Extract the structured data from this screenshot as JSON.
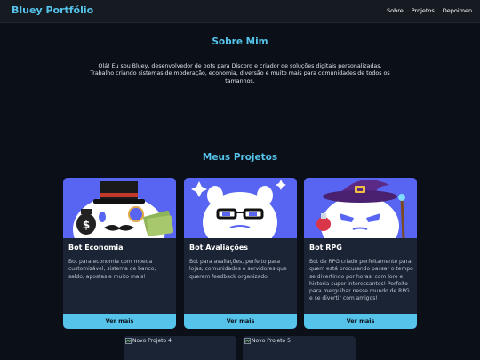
{
  "nav": {
    "brand": "Bluey Portfólio",
    "links": [
      "Sobre",
      "Projetos",
      "Depoimen"
    ]
  },
  "about": {
    "title": "Sobre Mim",
    "text": "Olá! Eu sou Bluey, desenvolvedor de bots para Discord e criador de soluções digitais personalizadas. Trabalho criando sistemas de moderação, economia, diversão e muito mais para comunidades de todos os tamanhos."
  },
  "projects": {
    "title": "Meus Projetos",
    "cards": [
      {
        "title": "Bot Economia",
        "desc": "Bot para economia com moeda customizável, sistema de banco, saldo, apostas e muito mais!",
        "button": "Ver mais",
        "icon": "discord-economy-bot-icon"
      },
      {
        "title": "Bot Avaliações",
        "desc": "Bot para avaliações, perfeito para lojas, comunidades e servidores que querem feedback organizado.",
        "button": "Ver mais",
        "icon": "discord-reviews-bot-icon"
      },
      {
        "title": "Bot RPG",
        "desc": "Bot de RPG criado perfeitamente para quem está procurando passar o tempo se divertindo por horas, com lore e historia super interessantes! Perfeito para merguihar nesse mundo de RPG e se divertir com amigos!",
        "button": "Ver mais",
        "icon": "discord-rpg-bot-icon"
      }
    ],
    "more": [
      {
        "alt": "Novo Projeto 4"
      },
      {
        "alt": "Novo Projeto 5"
      }
    ]
  },
  "colors": {
    "accent": "#56c3ea",
    "background": "#0b0f17",
    "card": "#1b2434",
    "discord": "#5865f2"
  }
}
